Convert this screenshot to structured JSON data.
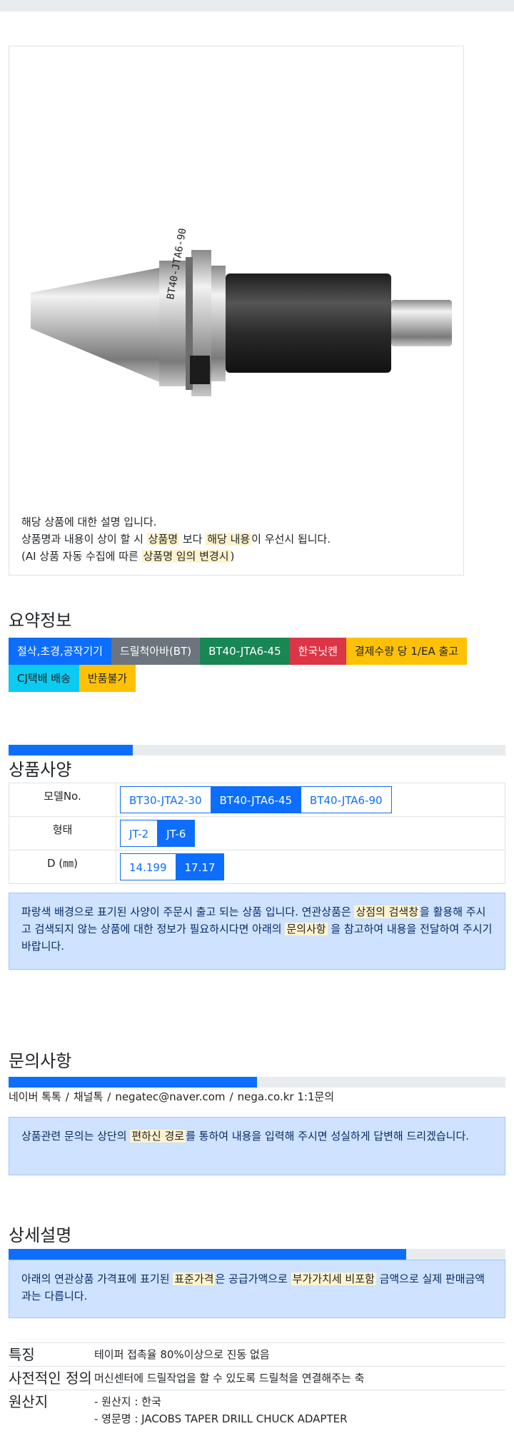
{
  "product": {
    "desc_lines": [
      {
        "parts": [
          "해당 상품에 대한 설명 입니다."
        ]
      },
      {
        "parts": [
          "상품명과 내용이 상이 할 시 ",
          "상품명",
          " 보다 ",
          "해당 내용",
          "이 우선시 됩니다."
        ]
      },
      {
        "parts": [
          "(AI 상품 자동 수집에 따른 ",
          "상품명 임의 변경시",
          ")"
        ]
      }
    ]
  },
  "summary": {
    "title": "요약정보",
    "badges": [
      "절삭,초경,공작기기",
      "드릴척아바(BT)",
      "BT40-JTA6-45",
      "한국닛켄",
      "결제수량 당 1/EA 출고",
      "CJ택배 배송",
      "반품불가"
    ]
  },
  "spec": {
    "title": "상품사양",
    "progress": 0.25,
    "rows": [
      {
        "label": "모델No.",
        "options": [
          "BT30-JTA2-30",
          "BT40-JTA6-45",
          "BT40-JTA6-90"
        ],
        "selected": 1
      },
      {
        "label": "형태",
        "options": [
          "JT-2",
          "JT-6"
        ],
        "selected": 1
      },
      {
        "label": "D (㎜)",
        "options": [
          "14.199",
          "17.17"
        ],
        "selected": 1
      }
    ],
    "notice": [
      "파랑색 배경으로 표기된 사양이 주문시 출고 되는 상품 입니다. 연관상품은 ",
      "상점의 검색창",
      "을 활용해 주시고 검색되지 않는 상품에 대한 정보가 필요하시다면 아래의 ",
      "문의사항",
      " 을 참고하여 내용을 전달하여 주시기 바랍니다."
    ]
  },
  "inquiry": {
    "title": "문의사항",
    "progress": 0.5,
    "contacts": [
      "네이버 톡톡",
      "채널톡",
      "negatec@naver.com",
      "nega.co.kr 1:1문의"
    ],
    "separator": "/",
    "notice": [
      "상품관련 문의는 상단의 ",
      "편하신 경로",
      "를 통하여 내용을 입력해 주시면 성실하게 답변해 드리겠습니다."
    ]
  },
  "detail": {
    "title": "상세설명",
    "progress": 0.8,
    "notice": [
      "아래의 연관상품 가격표에 표기된 ",
      "표준가격",
      "은 공급가액으로 ",
      "부가가치세 비포함",
      " 금액으로 실제 판매금액과는 다릅니다."
    ],
    "features": [
      {
        "label": "특징",
        "values": [
          "테이퍼 접촉율 80%이상으로 진동 없음"
        ]
      },
      {
        "label": "사전적인 정의",
        "values": [
          "머신센터에 드릴작업을 할 수 있도록 드릴척을 연결해주는 축"
        ]
      },
      {
        "label": "원산지",
        "values": [
          "- 원산지 : 한국",
          "- 영문명 : JACOBS TAPER DRILL CHUCK ADAPTER"
        ]
      }
    ]
  },
  "colors": {
    "primary": "#0d6efd",
    "highlight": "#fff3cd",
    "alert_bg": "#cfe2ff"
  }
}
